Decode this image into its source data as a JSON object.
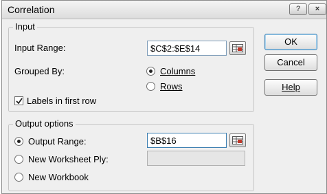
{
  "window": {
    "title": "Correlation",
    "help_glyph": "?",
    "close_glyph": "×"
  },
  "input_group": {
    "legend": "Input",
    "input_range_label": "Input Range:",
    "input_range_value": "$C$2:$E$14",
    "grouped_by_label": "Grouped By:",
    "columns_label": "Columns",
    "rows_label": "Rows",
    "grouped_by_selected": "Columns",
    "labels_first_row_label": "Labels in first row",
    "labels_first_row_checked": true
  },
  "output_group": {
    "legend": "Output options",
    "output_range_label": "Output Range:",
    "output_range_value": "$B$16",
    "new_worksheet_label": "New Worksheet Ply:",
    "new_worksheet_value": "",
    "new_workbook_label": "New Workbook",
    "selected": "Output Range"
  },
  "buttons": {
    "ok": "OK",
    "cancel": "Cancel",
    "help": "Help"
  },
  "icons": {
    "range_picker": "range-select-icon",
    "checkmark": "checkmark-icon"
  }
}
